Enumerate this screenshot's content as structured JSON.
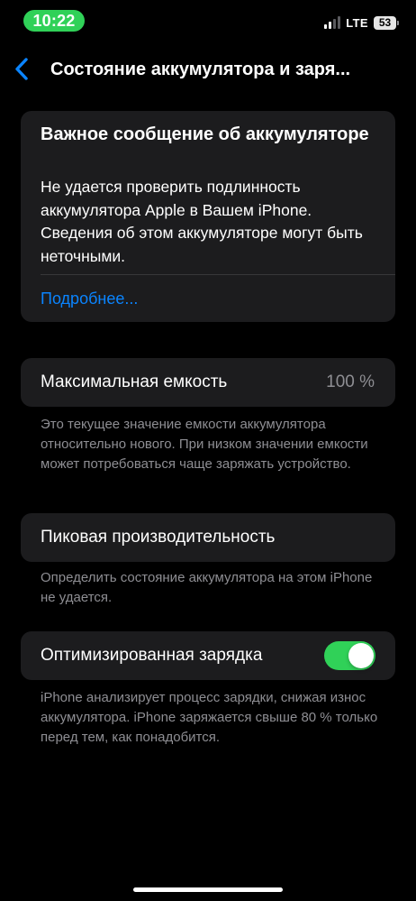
{
  "status_bar": {
    "time": "10:22",
    "network": "LTE",
    "battery": "53",
    "signal_icon": "cellular-signal-icon",
    "battery_icon": "battery-icon"
  },
  "nav": {
    "title": "Состояние аккумулятора и заря...",
    "back_icon": "chevron-left-icon"
  },
  "alert": {
    "title": "Важное сообщение об аккумуляторе",
    "body": "Не удается проверить подлинность аккумулятора Apple в Вашем iPhone. Сведения об этом аккумуляторе могут быть неточными.",
    "link": "Подробнее..."
  },
  "max_capacity": {
    "label": "Максимальная емкость",
    "value": "100 %",
    "footnote": "Это текущее значение емкости аккумуля­тора относительно нового. При низком значении емкости может потребоваться чаще заряжать устройство."
  },
  "peak_performance": {
    "label": "Пиковая производительность",
    "footnote": "Определить состояние аккумулятора на этом iPhone не удается."
  },
  "optimized_charging": {
    "label": "Оптимизированная зарядка",
    "enabled": true,
    "footnote": "iPhone анализирует процесс зарядки, снижая износ аккумулятора. iPhone заряжается свыше 80 % только перед тем, как понадобится."
  },
  "colors": {
    "background": "#000000",
    "card": "#1c1c1e",
    "accent_blue": "#0a84ff",
    "toggle_green": "#30d158",
    "secondary_text": "#8e8e93"
  }
}
